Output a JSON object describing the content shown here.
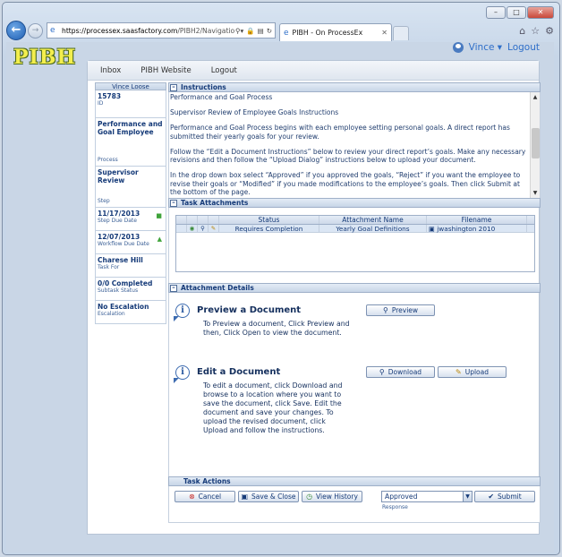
{
  "browser": {
    "url_domain": "https://processex.saasfactory.com",
    "url_path": "/PIBH2/Navigation_Co",
    "tab_title": "PIBH - On ProcessEx",
    "win_min": "–",
    "win_max": "□",
    "win_close": "✕"
  },
  "header": {
    "logo": "PIBH",
    "user_name": "Vince",
    "logout": "Logout"
  },
  "appbar": {
    "items": [
      "Inbox",
      "PIBH Website",
      "Logout"
    ]
  },
  "sidebar": {
    "header": "Vince Loose",
    "items": [
      {
        "value": "15783",
        "label": "ID"
      },
      {
        "value": "Performance and Goal Employee",
        "label": "Process"
      },
      {
        "value": "Supervisor Review",
        "label": "Step"
      },
      {
        "value": "11/17/2013",
        "label": "Step Due Date"
      },
      {
        "value": "12/07/2013",
        "label": "Workflow Due Date"
      },
      {
        "value": "Charese Hill",
        "label": "Task For"
      },
      {
        "value": "0/0 Completed",
        "label": "Subtask Status"
      },
      {
        "value": "No Escalation",
        "label": "Escalation"
      }
    ]
  },
  "instructions": {
    "title": "Instructions",
    "paragraphs": [
      "Performance and Goal Process",
      "Supervisor Review of Employee Goals Instructions",
      "Performance and Goal Process begins with each employee setting personal goals.  A direct report has submitted their yearly goals for your review.",
      "Follow the “Edit a Document Instructions” below to review your direct report’s goals.  Make any necessary revisions and then follow the “Upload Dialog” instructions below to upload your document.",
      "In the drop down box select “Approved” if you approved the goals, “Reject” if you want the employee to revise their goals or “Modified” if you made modifications to the employee’s goals.   Then click Submit at the bottom of the page."
    ]
  },
  "attachments": {
    "title": "Task Attachments",
    "columns": [
      "Status",
      "Attachment Name",
      "Filename"
    ],
    "rows": [
      {
        "status": "Requires Completion",
        "name": "Yearly Goal Definitions",
        "filename": "jwashington 2010"
      }
    ]
  },
  "details": {
    "title": "Attachment Details",
    "preview_title": "Preview a Document",
    "preview_text": "To Preview a document, Click Preview and then, Click Open to view the document.",
    "preview_button": "Preview",
    "edit_title": "Edit a Document",
    "edit_text": "To edit a document, click Download and browse to a location where you want to save the document, click Save. Edit the document and save your changes. To upload the revised document, click Upload and follow the instructions.",
    "download_button": "Download",
    "upload_button": "Upload"
  },
  "actions": {
    "title": "Task Actions",
    "cancel": "Cancel",
    "save_close": "Save & Close",
    "view_history": "View History",
    "response_value": "Approved",
    "response_label": "Response",
    "submit": "Submit"
  }
}
